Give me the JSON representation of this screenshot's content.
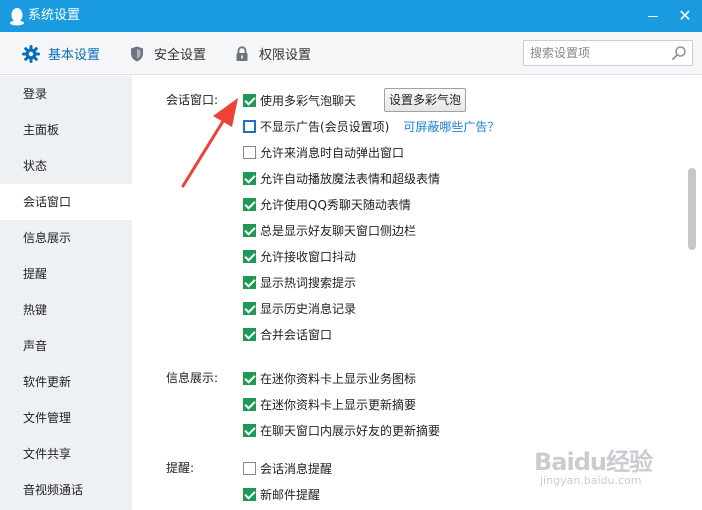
{
  "window": {
    "title": "系统设置"
  },
  "tabs": [
    {
      "label": "基本设置",
      "icon": "gear-icon",
      "active": true
    },
    {
      "label": "安全设置",
      "icon": "shield-icon",
      "active": false
    },
    {
      "label": "权限设置",
      "icon": "lock-icon",
      "active": false
    }
  ],
  "search": {
    "placeholder": "搜索设置项"
  },
  "sidebar": {
    "items": [
      {
        "label": "登录"
      },
      {
        "label": "主面板"
      },
      {
        "label": "状态"
      },
      {
        "label": "会话窗口",
        "selected": true
      },
      {
        "label": "信息展示"
      },
      {
        "label": "提醒"
      },
      {
        "label": "热键"
      },
      {
        "label": "声音"
      },
      {
        "label": "软件更新"
      },
      {
        "label": "文件管理"
      },
      {
        "label": "文件共享"
      },
      {
        "label": "音视频通话"
      }
    ]
  },
  "sections": {
    "chat_window": {
      "label": "会话窗口:",
      "bubble_button": "设置多彩气泡",
      "options": [
        {
          "label": "使用多彩气泡聊天",
          "checked": true
        },
        {
          "label": "不显示广告(会员设置项)",
          "checked": false,
          "link": "可屏蔽哪些广告？"
        },
        {
          "label": "允许来消息时自动弹出窗口",
          "checked": false
        },
        {
          "label": "允许自动播放魔法表情和超级表情",
          "checked": true
        },
        {
          "label": "允许使用QQ秀聊天随动表情",
          "checked": true
        },
        {
          "label": "总是显示好友聊天窗口侧边栏",
          "checked": true
        },
        {
          "label": "允许接收窗口抖动",
          "checked": true
        },
        {
          "label": "显示热词搜索提示",
          "checked": true
        },
        {
          "label": "显示历史消息记录",
          "checked": true
        },
        {
          "label": "合并会话窗口",
          "checked": true
        }
      ]
    },
    "info_display": {
      "label": "信息展示:",
      "options": [
        {
          "label": "在迷你资料卡上显示业务图标",
          "checked": true
        },
        {
          "label": "在迷你资料卡上显示更新摘要",
          "checked": true
        },
        {
          "label": "在聊天窗口内展示好友的更新摘要",
          "checked": true
        }
      ]
    },
    "reminder": {
      "label": "提醒:",
      "options": [
        {
          "label": "会话消息提醒",
          "checked": false
        },
        {
          "label": "新邮件提醒",
          "checked": true
        }
      ]
    }
  },
  "colors": {
    "titlebar": "#1a9be0",
    "accent": "#0a6fb8",
    "check": "#1e9a55",
    "link": "#1a84d6",
    "arrow": "#ef4136"
  },
  "watermark": {
    "main": "Baidu经验",
    "sub": "jingyan.baidu.com"
  }
}
